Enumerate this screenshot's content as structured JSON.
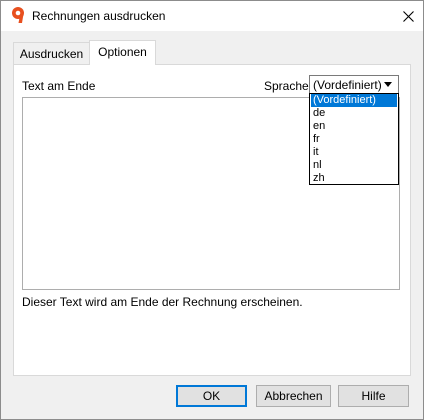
{
  "window": {
    "title": "Rechnungen ausdrucken"
  },
  "tabs": [
    {
      "label": "Ausdrucken",
      "active": false
    },
    {
      "label": "Optionen",
      "active": true
    }
  ],
  "options": {
    "text_label": "Text am Ende",
    "language_label": "Sprache",
    "language_selected": "(Vordefiniert)",
    "language_options": [
      "(Vordefiniert)",
      "de",
      "en",
      "fr",
      "it",
      "nl",
      "zh"
    ],
    "textarea_value": "",
    "info": "Dieser Text wird am Ende der Rechnung erscheinen."
  },
  "buttons": {
    "ok": "OK",
    "cancel": "Abbrechen",
    "help": "Hilfe"
  },
  "colors": {
    "accent": "#0078d7",
    "app_icon": "#e8501f"
  },
  "icons": {
    "app": "app-logo-icon",
    "close": "close-icon",
    "dropdown": "chevron-down-icon"
  }
}
